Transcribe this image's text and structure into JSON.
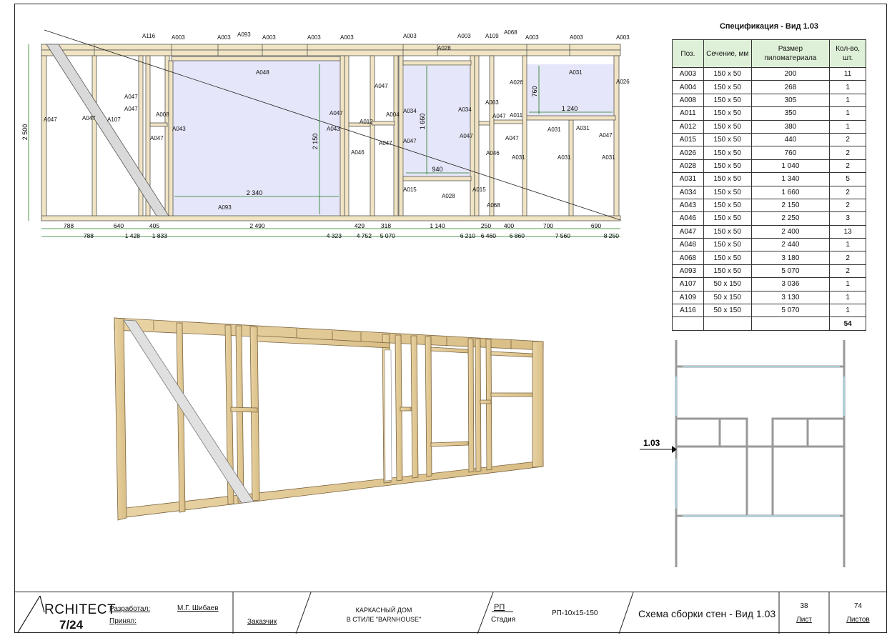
{
  "plan": {
    "ids": {
      "a116": "A116",
      "a003": "A003",
      "a093": "A093",
      "a028": "A028",
      "a109": "A109",
      "a068": "A068",
      "a048": "A048",
      "a031": "A031",
      "a026": "A026",
      "a047": "A047",
      "a107": "A107",
      "a008": "A008",
      "a043": "A043",
      "a012": "A012",
      "a004": "A004",
      "a034": "A034",
      "a011": "A011",
      "a046": "A046",
      "a015": "A015"
    },
    "dims": {
      "h2500": "2 500",
      "h2150": "2 150",
      "h1660": "1 660",
      "h760": "760",
      "w2340": "2 340",
      "w940": "940",
      "w1240": "1 240"
    },
    "segments": [
      "788",
      "640",
      "405",
      "2 490",
      "429",
      "318",
      "1 140",
      "250",
      "400",
      "700",
      "690"
    ],
    "cumulative": [
      "788",
      "1 428",
      "1 833",
      "4 323",
      "4 752",
      "5 070",
      "6 210",
      "6 460",
      "6 860",
      "7 560",
      "8 250"
    ]
  },
  "spec": {
    "title": "Спецификация - Вид 1.03",
    "headers": [
      "Поз.",
      "Сечение, мм",
      "Размер пиломатериала",
      "Кол-во, шт."
    ],
    "rows": [
      [
        "A003",
        "150 x 50",
        "200",
        "11"
      ],
      [
        "A004",
        "150 x 50",
        "268",
        "1"
      ],
      [
        "A008",
        "150 x 50",
        "305",
        "1"
      ],
      [
        "A011",
        "150 x 50",
        "350",
        "1"
      ],
      [
        "A012",
        "150 x 50",
        "380",
        "1"
      ],
      [
        "A015",
        "150 x 50",
        "440",
        "2"
      ],
      [
        "A026",
        "150 x 50",
        "760",
        "2"
      ],
      [
        "A028",
        "150 x 50",
        "1 040",
        "2"
      ],
      [
        "A031",
        "150 x 50",
        "1 340",
        "5"
      ],
      [
        "A034",
        "150 x 50",
        "1 660",
        "2"
      ],
      [
        "A043",
        "150 x 50",
        "2 150",
        "2"
      ],
      [
        "A046",
        "150 x 50",
        "2 250",
        "3"
      ],
      [
        "A047",
        "150 x 50",
        "2 400",
        "13"
      ],
      [
        "A048",
        "150 x 50",
        "2 440",
        "1"
      ],
      [
        "A068",
        "150 x 50",
        "3 180",
        "2"
      ],
      [
        "A093",
        "150 x 50",
        "5 070",
        "2"
      ],
      [
        "A107",
        "50 x 150",
        "3 036",
        "1"
      ],
      [
        "A109",
        "50 x 150",
        "3 130",
        "1"
      ],
      [
        "A116",
        "50 x 150",
        "5 070",
        "1"
      ]
    ],
    "total": "54"
  },
  "key_plan": {
    "view_label": "1.03"
  },
  "title_block": {
    "logo_line1": "RCHITECT",
    "logo_line2": "7/24",
    "developed_label": "Разработал:",
    "developed_name": "М.Г. Шибаев",
    "accepted_label": "Принял:",
    "customer_label": "Заказчик",
    "project_line1": "КАРКАСНЫЙ ДОМ",
    "project_line2": "В СТИЛЕ \"BARNHOUSE\"",
    "stage_code": "РП",
    "stage_label": "Стадия",
    "doc_code": "РП-10x15-150",
    "sheet_title": "Схема сборки стен - Вид 1.03",
    "sheet_no": "38",
    "sheet_label": "Лист",
    "sheets_total": "74",
    "sheets_label": "Листов"
  }
}
